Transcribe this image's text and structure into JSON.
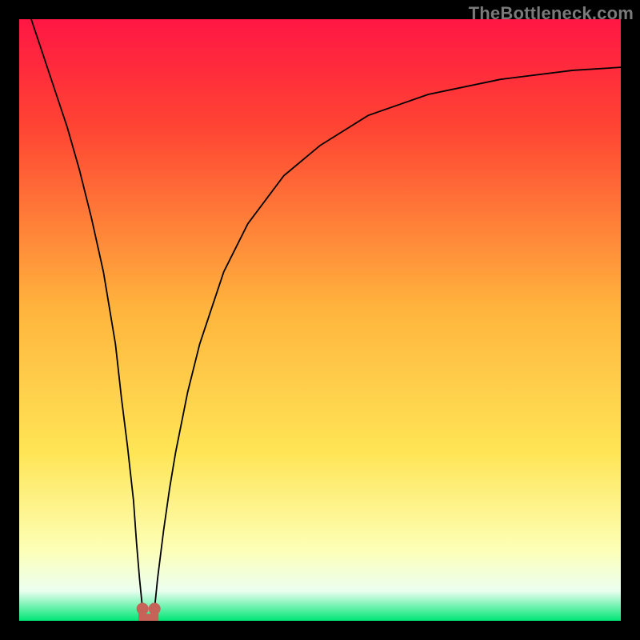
{
  "watermark": "TheBottleneck.com",
  "colors": {
    "frame": "#000000",
    "gradient_top": "#ff1744",
    "gradient_mid_upper": "#ff4433",
    "gradient_mid": "#ffb43d",
    "gradient_mid_lower": "#ffe556",
    "gradient_lower": "#fdffb5",
    "gradient_white": "#ecfff0",
    "gradient_bottom": "#00e676",
    "curve": "#000000",
    "marker": "#c66258"
  },
  "chart_data": {
    "type": "line",
    "title": "",
    "xlabel": "",
    "ylabel": "",
    "xlim": [
      0,
      100
    ],
    "ylim": [
      0,
      100
    ],
    "grid": false,
    "series": [
      {
        "name": "left-branch",
        "x": [
          2,
          4,
          6,
          8,
          10,
          12,
          14,
          16,
          17,
          18,
          19,
          19.5,
          20,
          20.5
        ],
        "y": [
          100,
          94,
          88,
          82,
          75,
          67,
          58,
          46,
          37,
          29,
          20,
          13,
          7,
          2
        ]
      },
      {
        "name": "right-branch",
        "x": [
          22.5,
          23,
          24,
          25,
          26,
          28,
          30,
          34,
          38,
          44,
          50,
          58,
          68,
          80,
          92,
          100
        ],
        "y": [
          2,
          7,
          15,
          22,
          28,
          38,
          46,
          58,
          66,
          74,
          79,
          84,
          87.5,
          90,
          91.5,
          92
        ]
      }
    ],
    "annotations": [
      {
        "name": "min-left-marker",
        "x": 20.5,
        "y": 2
      },
      {
        "name": "min-right-marker",
        "x": 22.5,
        "y": 2
      },
      {
        "name": "min-link",
        "x_from": 20.5,
        "x_to": 22.5,
        "y": 0.5
      }
    ]
  }
}
